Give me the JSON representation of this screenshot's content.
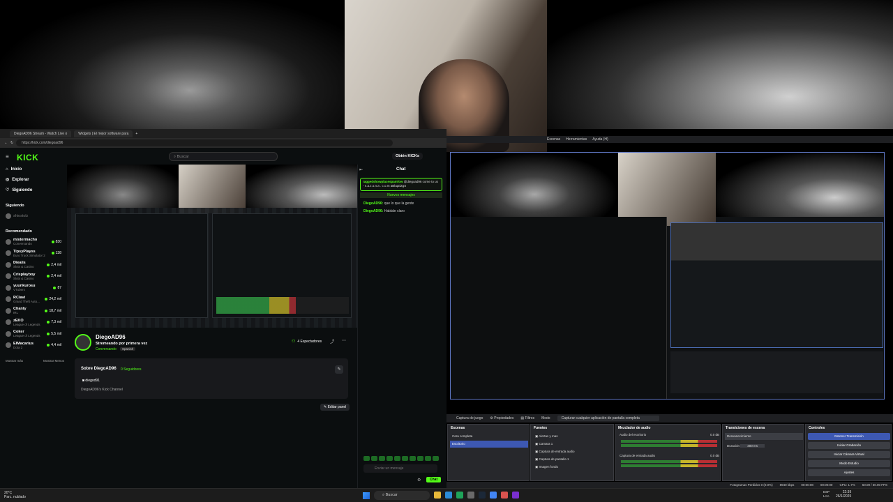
{
  "browser": {
    "tabs": [
      "DiegoAD96 Stream - Watch Live o",
      "Widgets | El mejor software para"
    ],
    "url": "https://kick.com/diegoad96"
  },
  "kick": {
    "logo": "KICK",
    "search_placeholder": "Buscar",
    "get_kicks": "Obtén KICKs",
    "nav": [
      "Inicio",
      "Explorar",
      "Siguiendo"
    ],
    "following_title": "Siguiendo",
    "following_user": "shiostolz",
    "recommended_title": "Recomendado",
    "recommended": [
      {
        "name": "mistermacho",
        "game": "Conversando",
        "count": "830"
      },
      {
        "name": "TipsyPlayss",
        "game": "Euro Truck Simulator 2",
        "count": "138"
      },
      {
        "name": "Diealis",
        "game": "Slots & Casino",
        "count": "2,4 mil"
      },
      {
        "name": "Crisplayboy",
        "game": "Slots & Casino",
        "count": "2,4 mil"
      },
      {
        "name": "yuunkurosu",
        "game": "VTubers",
        "count": "87"
      },
      {
        "name": "RClavi",
        "game": "Grand Theft Auto...",
        "count": "24,2 mil"
      },
      {
        "name": "Chanty",
        "game": "IRL",
        "count": "18,7 mil"
      },
      {
        "name": "zEKO",
        "game": "League of Legends",
        "count": "7,3 mil"
      },
      {
        "name": "Coker",
        "game": "League of Legends",
        "count": "5,5 mil"
      },
      {
        "name": "ElMacarius",
        "game": "Dota 2",
        "count": "4,4 mil"
      }
    ],
    "show_more": "Mostrar más",
    "show_less": "Mostrar Menos",
    "streamer": "DiegoAD96",
    "stream_title": "Stremeando por primera vez",
    "category": "Conversando",
    "language": "Spanish",
    "viewers": "4 Espectadores",
    "about_title": "Sobre DiegoAD96",
    "followers": "0 Seguidores",
    "about_user": "diegod91",
    "about_desc": "DiegoAD96's Kick Channel",
    "edit_panel": "Editar panel"
  },
  "chat": {
    "title": "Chat",
    "pinned_user": "raggedshowplacespamfow",
    "pinned_text": "@diegoad96 corne to us - n.a.z.o.n.a . c.o.m aBbqZiZgS",
    "new_messages": "Nuevos mensajes",
    "messages": [
      {
        "user": "DiegoAD96:",
        "text": "que lo que la gente"
      },
      {
        "user": "DiegoAD96:",
        "text": "Hablale claro"
      }
    ],
    "input_placeholder": "Enviar un mensaje",
    "send": "Chat"
  },
  "obs": {
    "menu": [
      "Escenas",
      "Herramientas",
      "Ayuda (H)"
    ],
    "toolbar": {
      "source": "Captura de juego",
      "properties": "Propiedades",
      "filters": "Filtros",
      "mode_label": "Modo",
      "mode_value": "Capturar cualquier aplicación de pantalla completa"
    },
    "scenes_title": "Escenas",
    "scenes": [
      "Cara completa",
      "Escritorio"
    ],
    "sources_title": "Fuentes",
    "sources": [
      "Alertas y mas",
      "Camara 1",
      "Captura de entrada audio",
      "Captura de pantalla 1",
      "Imagen fondo"
    ],
    "mixer_title": "Mezclador de audio",
    "mixer": [
      {
        "name": "Audio del escritorio",
        "level": "0.0 dB"
      },
      {
        "name": "Captura de entrada audio",
        "level": "0.0 dB"
      }
    ],
    "transitions_title": "Transiciones de escena",
    "transition": "Desvanecimiento",
    "duration_label": "Duración",
    "duration": "300 ms",
    "controls_title": "Controles",
    "controls": [
      "Detener Transmisión",
      "Iniciar Grabación",
      "Iniciar Cámara Virtual",
      "Modo Estudio",
      "Ajustes"
    ],
    "status": [
      "Fotogramas Perdidos 0 (0.0%)",
      "8940 kbps",
      "00:00:08",
      "00:00:00",
      "CPU: 1.7%",
      "60.00 / 60.00 FPS"
    ]
  },
  "taskbar": {
    "weather_temp": "20°C",
    "weather_desc": "Parc. nublado",
    "search": "Buscar",
    "lang": "ESP",
    "lang2": "LAA",
    "time": "22:39",
    "date": "26/1/2025"
  }
}
